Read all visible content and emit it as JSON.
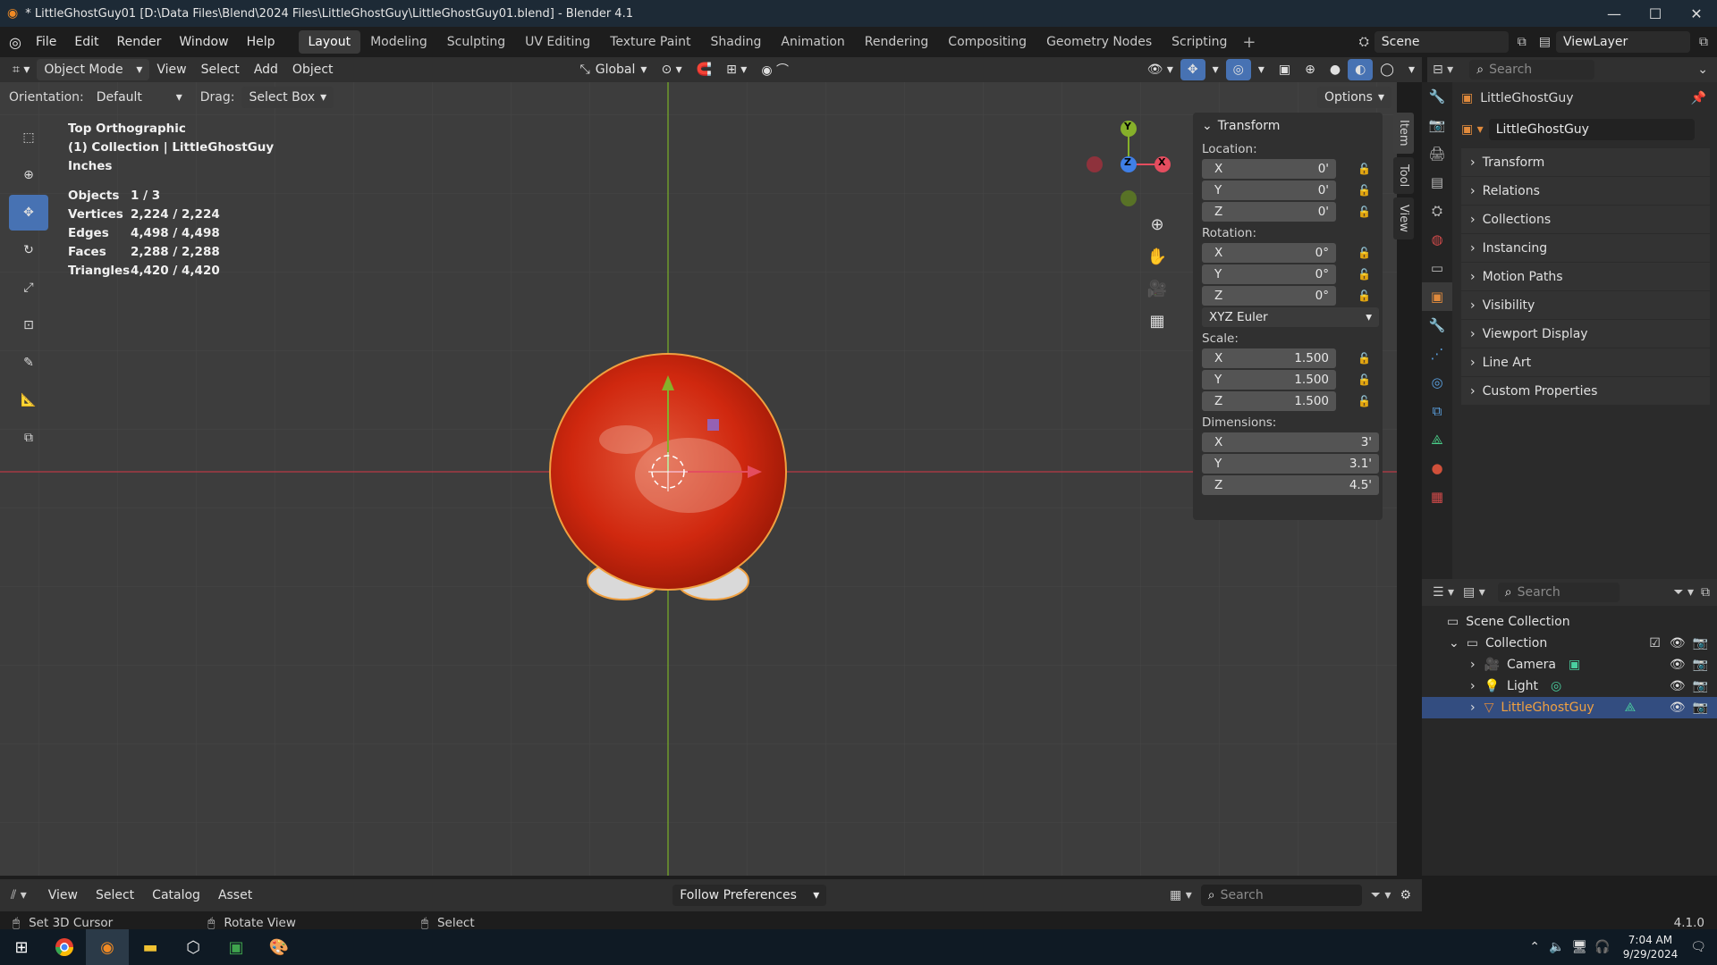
{
  "window": {
    "title": "* LittleGhostGuy01 [D:\\Data Files\\Blend\\2024 Files\\LittleGhostGuy\\LittleGhostGuy01.blend] - Blender 4.1",
    "minimize": "—",
    "maximize": "☐",
    "close": "✕"
  },
  "menu": {
    "items": [
      "File",
      "Edit",
      "Render",
      "Window",
      "Help"
    ]
  },
  "workspaces": {
    "items": [
      "Layout",
      "Modeling",
      "Sculpting",
      "UV Editing",
      "Texture Paint",
      "Shading",
      "Animation",
      "Rendering",
      "Compositing",
      "Geometry Nodes",
      "Scripting"
    ],
    "active": "Layout"
  },
  "scene": {
    "name": "Scene",
    "view_layer": "ViewLayer"
  },
  "viewport_header": {
    "mode": "Object Mode",
    "view": "View",
    "select": "Select",
    "add": "Add",
    "object": "Object",
    "transform_orientation": "Global"
  },
  "tool_options": {
    "orientation_label": "Orientation:",
    "orientation_value": "Default",
    "drag_label": "Drag:",
    "drag_value": "Select Box",
    "options": "Options"
  },
  "overlay_text": {
    "view_name": "Top Orthographic",
    "collection": "(1) Collection | LittleGhostGuy",
    "units": "Inches"
  },
  "stats": [
    {
      "key": "Objects",
      "value": "1 / 3"
    },
    {
      "key": "Vertices",
      "value": "2,224 / 2,224"
    },
    {
      "key": "Edges",
      "value": "4,498 / 4,498"
    },
    {
      "key": "Faces",
      "value": "2,288 / 2,288"
    },
    {
      "key": "Triangles",
      "value": "4,420 / 4,420"
    }
  ],
  "gizmo": {
    "y": "Y",
    "x": "X",
    "z": "Z"
  },
  "npanel": {
    "title": "Transform",
    "location_label": "Location:",
    "location": [
      {
        "axis": "X",
        "value": "0'"
      },
      {
        "axis": "Y",
        "value": "0'"
      },
      {
        "axis": "Z",
        "value": "0'"
      }
    ],
    "rotation_label": "Rotation:",
    "rotation": [
      {
        "axis": "X",
        "value": "0°"
      },
      {
        "axis": "Y",
        "value": "0°"
      },
      {
        "axis": "Z",
        "value": "0°"
      }
    ],
    "rotation_mode": "XYZ Euler",
    "scale_label": "Scale:",
    "scale": [
      {
        "axis": "X",
        "value": "1.500"
      },
      {
        "axis": "Y",
        "value": "1.500"
      },
      {
        "axis": "Z",
        "value": "1.500"
      }
    ],
    "dimensions_label": "Dimensions:",
    "dimensions": [
      {
        "axis": "X",
        "value": "3'"
      },
      {
        "axis": "Y",
        "value": "3.1'"
      },
      {
        "axis": "Z",
        "value": "4.5'"
      }
    ],
    "tabs": [
      "Item",
      "Tool",
      "View"
    ]
  },
  "properties": {
    "search_placeholder": "Search",
    "object_name": "LittleGhostGuy",
    "object_field": "LittleGhostGuy",
    "sections": [
      "Transform",
      "Relations",
      "Collections",
      "Instancing",
      "Motion Paths",
      "Visibility",
      "Viewport Display",
      "Line Art",
      "Custom Properties"
    ]
  },
  "outliner": {
    "search_placeholder": "Search",
    "scene_collection": "Scene Collection",
    "collection": "Collection",
    "items": [
      "Camera",
      "Light",
      "LittleGhostGuy"
    ]
  },
  "asset_bar": {
    "view": "View",
    "select": "Select",
    "catalog": "Catalog",
    "asset": "Asset",
    "follow": "Follow Preferences",
    "search_placeholder": "Search"
  },
  "status": {
    "left": "Set 3D Cursor",
    "middle": "Rotate View",
    "right": "Select",
    "version": "4.1.0"
  },
  "taskbar": {
    "time": "7:04 AM",
    "date": "9/29/2024"
  },
  "colors": {
    "accent": "#4772b3",
    "selected_orange": "#f0a040",
    "axis_x": "#e44d5f",
    "axis_y": "#86b02a",
    "axis_z": "#3f7fe6",
    "ghost_red": "#d6250e"
  }
}
